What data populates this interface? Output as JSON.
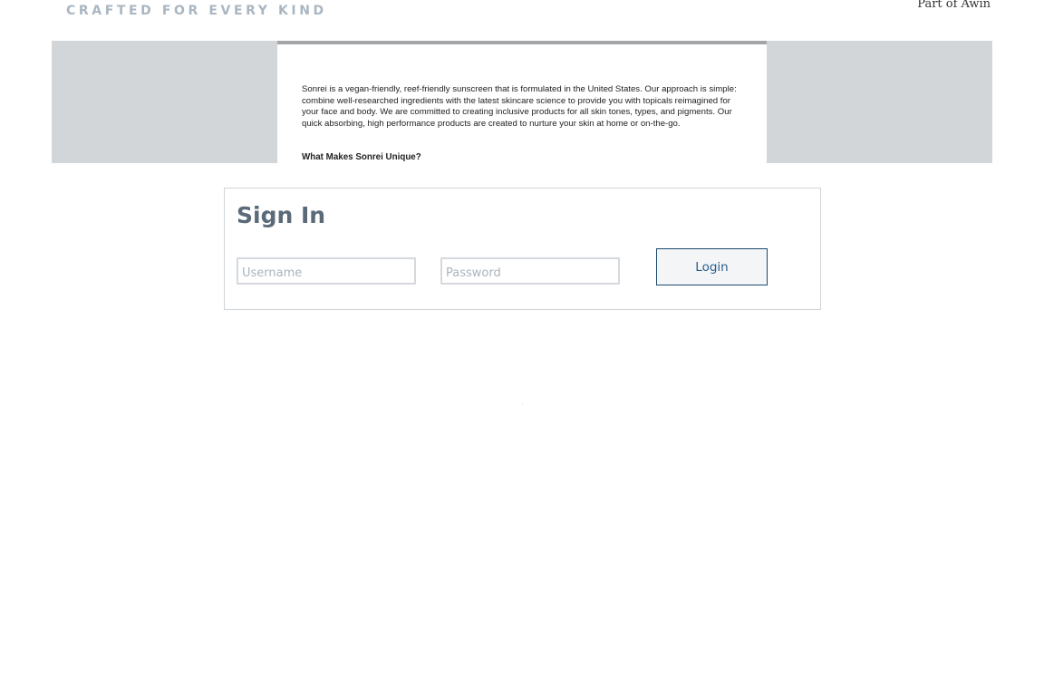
{
  "header": {
    "tagline": "CRAFTED FOR EVERY KIND",
    "awin_link": "Part of Awin"
  },
  "banner": {
    "description": "Sonrei is a vegan-friendly, reef-friendly sunscreen that is formulated in the United States. Our approach is simple: combine well-researched ingredients with the latest skincare science to provide you with topicals reimagined for your face and body. We are committed to creating inclusive products for all skin tones, types, and pigments. Our quick absorbing, high performance products are created to nurture your skin at home or on-the-go.",
    "heading": "What Makes Sonrei Unique?"
  },
  "signin": {
    "title": "Sign In",
    "username_placeholder": "Username",
    "username_value": "",
    "password_placeholder": "Password",
    "password_value": "",
    "login_label": "Login"
  }
}
